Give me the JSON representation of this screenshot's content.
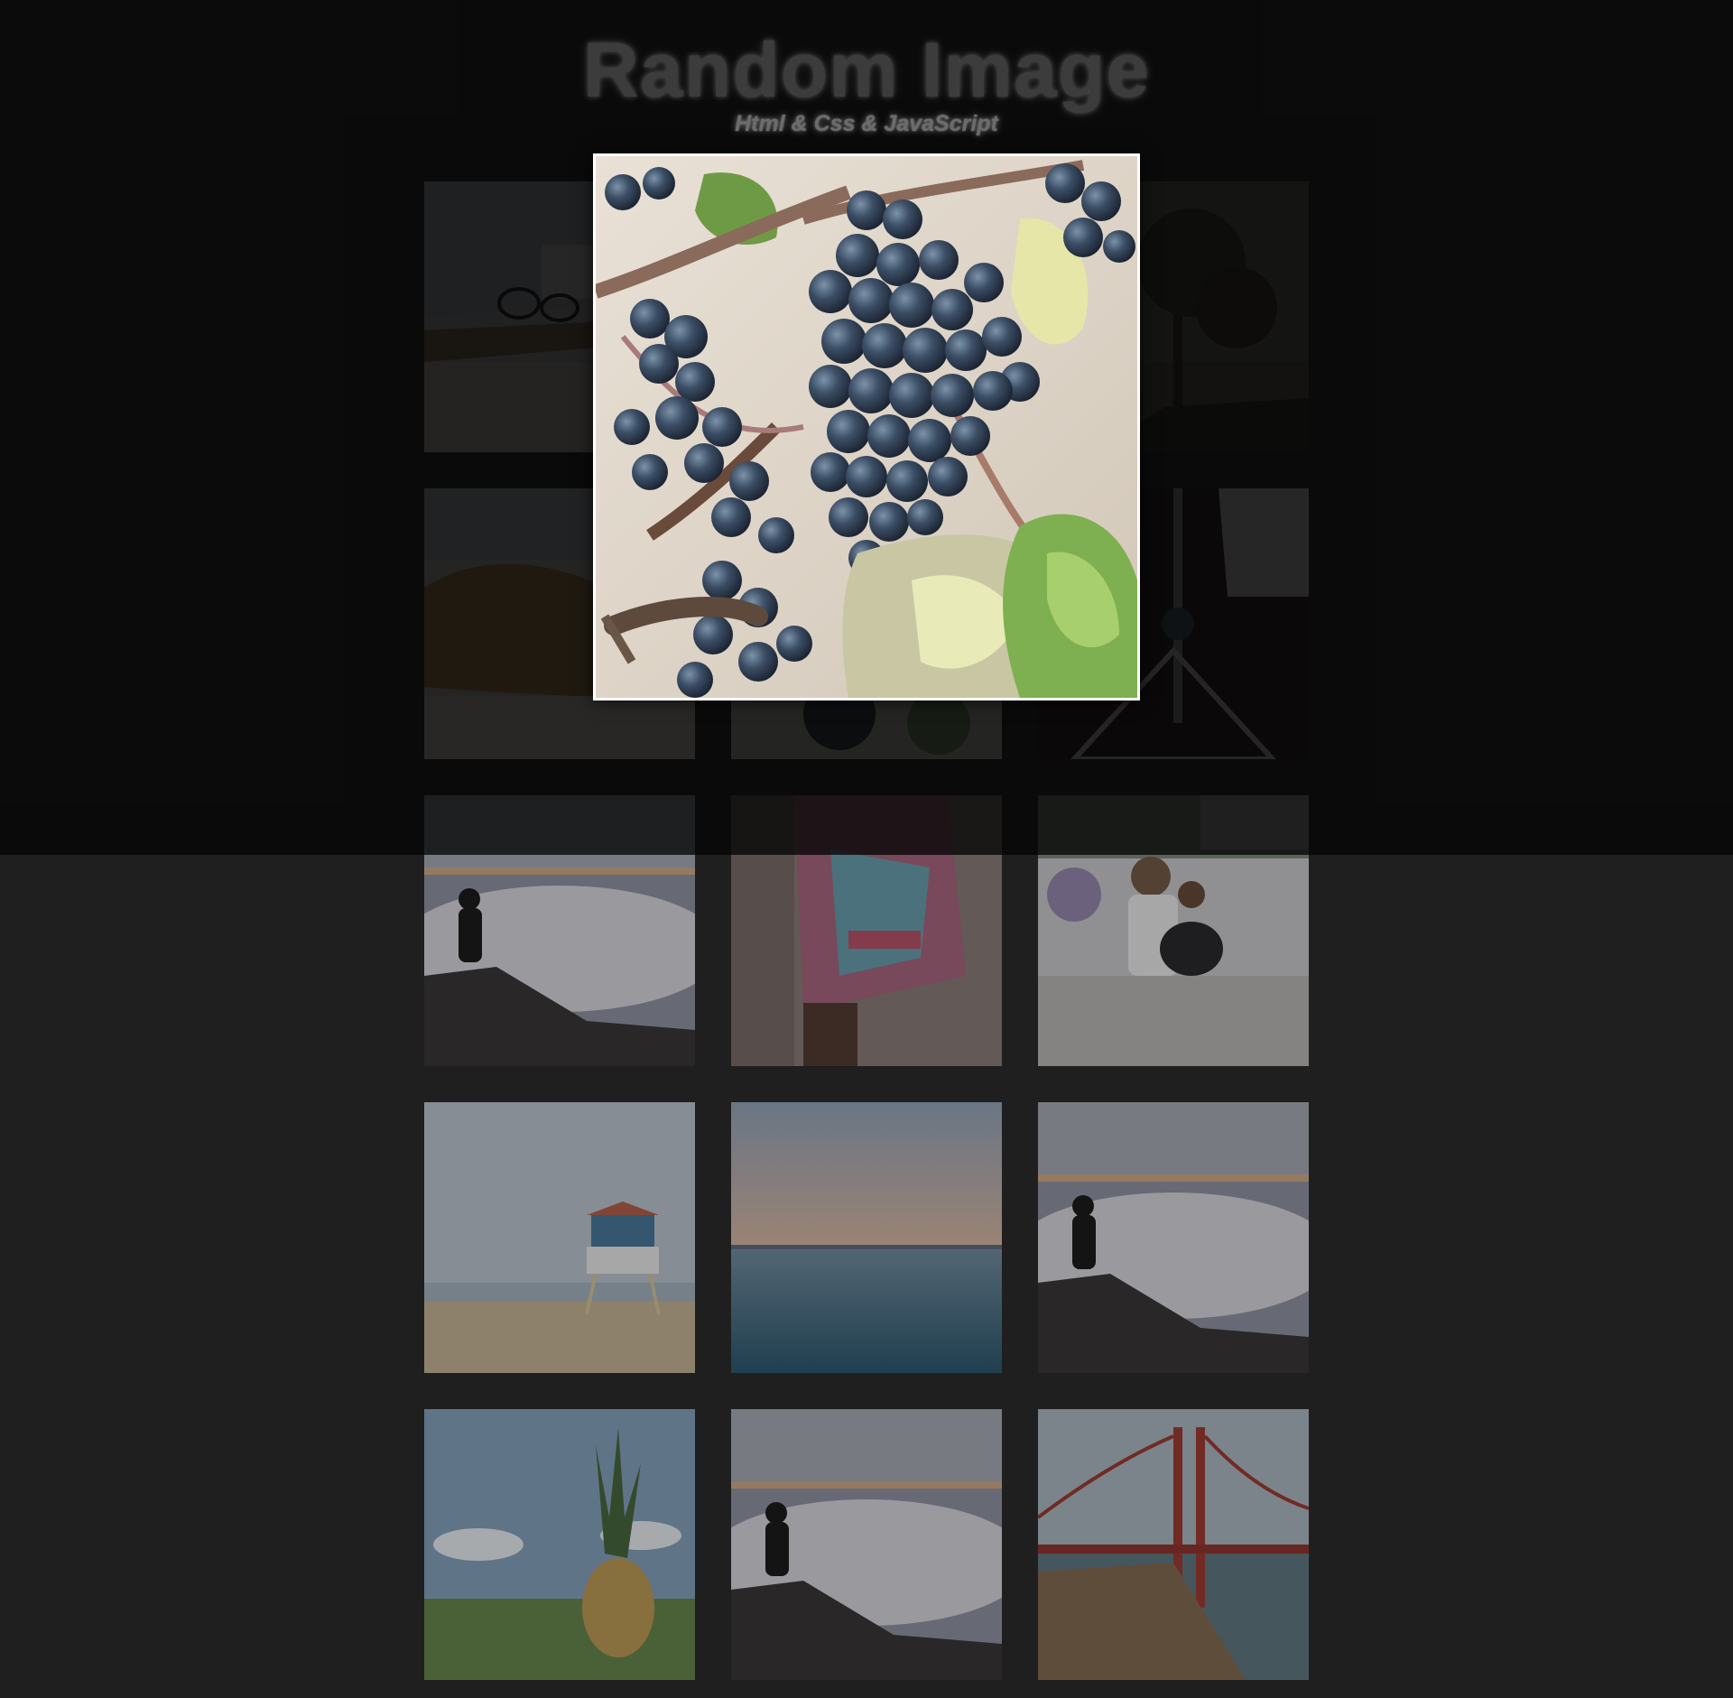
{
  "header": {
    "title": "Random Image",
    "subtitle": "Html & Css & JavaScript"
  },
  "gallery": {
    "images": [
      {
        "subject": "desk-with-glasses"
      },
      {
        "subject": "grapes"
      },
      {
        "subject": "tree-silhouette"
      },
      {
        "subject": "blanket-on-sand"
      },
      {
        "subject": "grapes"
      },
      {
        "subject": "sailboat-mast"
      },
      {
        "subject": "man-above-clouds"
      },
      {
        "subject": "colorful-scarf"
      },
      {
        "subject": "mother-and-child-on-street"
      },
      {
        "subject": "lifeguard-tower"
      },
      {
        "subject": "sea-horizon"
      },
      {
        "subject": "man-above-clouds"
      },
      {
        "subject": "pineapple-on-grass"
      },
      {
        "subject": "man-above-clouds"
      },
      {
        "subject": "golden-gate-bridge"
      }
    ]
  },
  "popup": {
    "subject": "grapes"
  },
  "colors": {
    "page_background": "#1f1f1f",
    "overlay": "#050505",
    "title_text": "#3c3c3c",
    "subtitle_text": "#6c6c6c",
    "popup_border": "#ffffff"
  }
}
